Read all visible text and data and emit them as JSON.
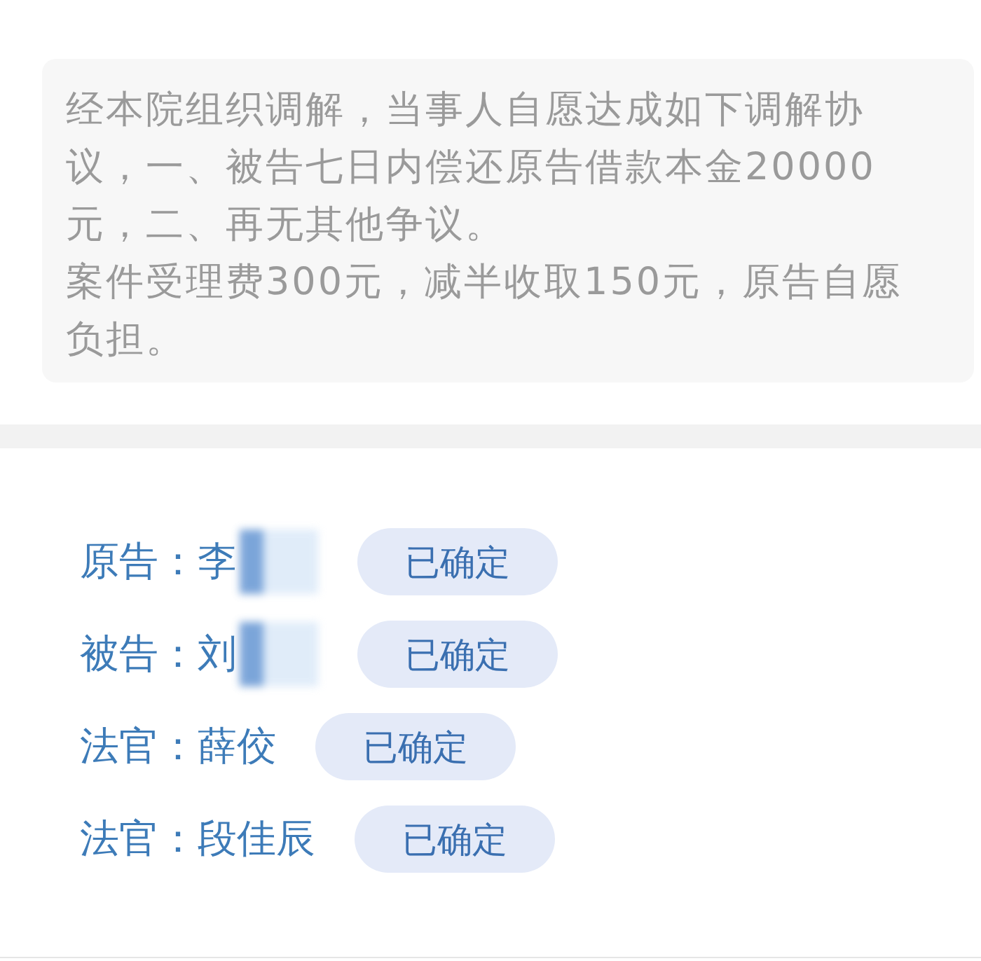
{
  "mediation_text": {
    "paragraphs": [
      "经本院组织调解，当事人自愿达成如下调解协议，一、被告七日内偿还原告借款本金20000元，二、再无其他争议。",
      "案件受理费300元，减半收取150元，原告自愿负担。"
    ]
  },
  "signatories": [
    {
      "role": "原告：",
      "name": "李",
      "redacted": true,
      "status": "已确定"
    },
    {
      "role": "被告：",
      "name": "刘",
      "redacted": true,
      "status": "已确定"
    },
    {
      "role": "法官：",
      "name": "薛佼",
      "redacted": false,
      "status": "已确定"
    },
    {
      "role": "法官：",
      "name": "段佳辰",
      "redacted": false,
      "status": "已确定"
    }
  ]
}
